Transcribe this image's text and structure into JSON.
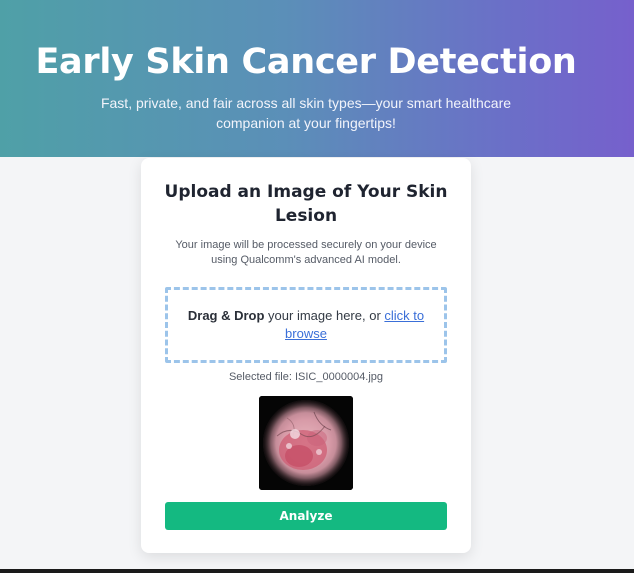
{
  "hero": {
    "title": "Early Skin Cancer Detection",
    "subtitle": "Fast, private, and fair across all skin types—your smart healthcare companion at your fingertips!"
  },
  "card": {
    "title": "Upload an Image of Your Skin Lesion",
    "description": "Your image will be processed securely on your device using Qualcomm's advanced AI model.",
    "dropzone": {
      "strong": "Drag & Drop",
      "middle": " your image here, or ",
      "link": "click to browse"
    },
    "selected_file": "Selected file: ISIC_0000004.jpg",
    "analyze_label": "Analyze"
  },
  "colors": {
    "accent": "#14b981",
    "link": "#3a6fd8",
    "dropzone_border": "#9cc4ea"
  }
}
